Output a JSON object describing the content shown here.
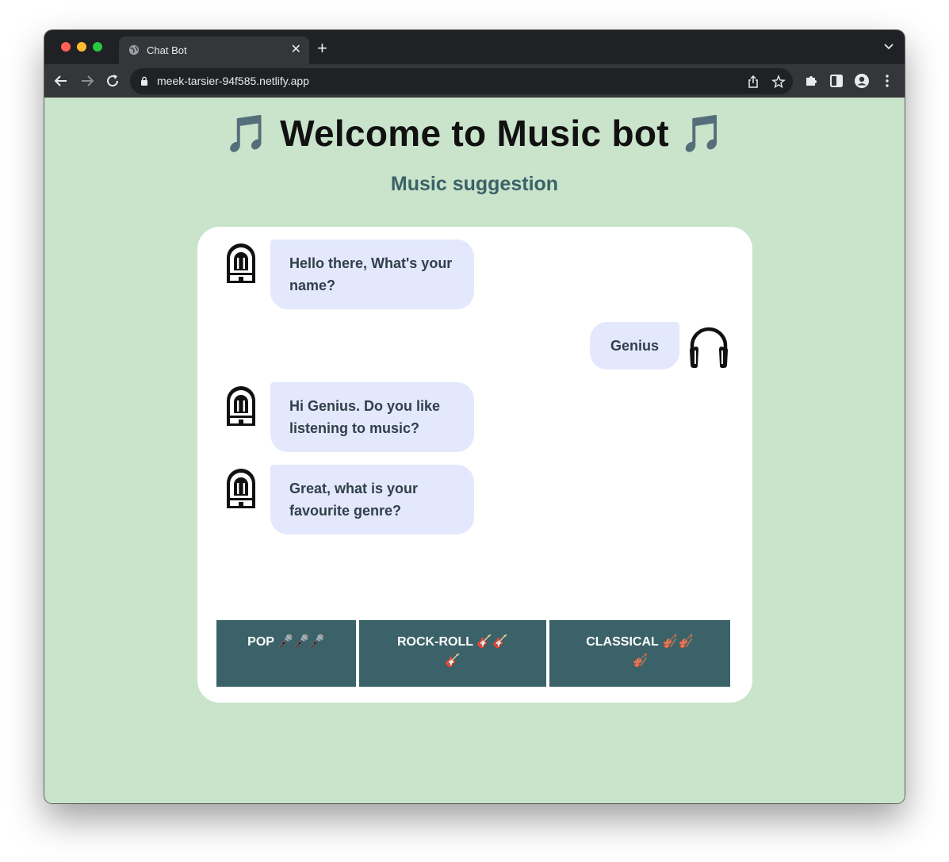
{
  "browser": {
    "tab_title": "Chat Bot",
    "tab_close": "✕",
    "new_tab": "+",
    "url": "meek-tarsier-94f585.netlify.app"
  },
  "page": {
    "title": "🎵 Welcome to Music bot 🎵",
    "subtitle": "Music suggestion"
  },
  "chat": {
    "messages": [
      {
        "sender": "bot",
        "avatar": "jukebox-icon",
        "text": "Hello there, What's your name?"
      },
      {
        "sender": "user",
        "avatar": "headphones-icon",
        "text": "Genius"
      },
      {
        "sender": "bot",
        "avatar": "jukebox-icon",
        "text": "Hi Genius. Do you like listening to music?"
      },
      {
        "sender": "bot",
        "avatar": "jukebox-icon",
        "text": "Great, what is your favourite genre?"
      }
    ],
    "choices": [
      {
        "label": "POP 🎤🎤🎤"
      },
      {
        "label": "ROCK-ROLL 🎸🎸🎸"
      },
      {
        "label": "CLASSICAL 🎻🎻🎻"
      }
    ]
  },
  "colors": {
    "page_background": "#c9e4cb",
    "accent": "#3b6268",
    "bubble": "#e3e8fd"
  }
}
